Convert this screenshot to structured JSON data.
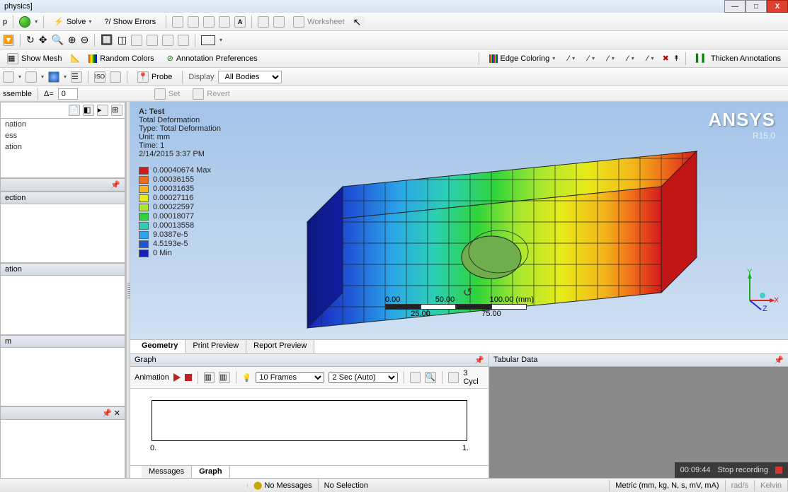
{
  "window": {
    "title_fragment": "physics]"
  },
  "window_buttons": {
    "min": "—",
    "max": "□",
    "close": "X"
  },
  "toolbar1": {
    "p_label": "p",
    "solve": "Solve",
    "show_errors": "?/ Show Errors",
    "worksheet": "Worksheet"
  },
  "toolbar3": {
    "show_mesh": "Show Mesh",
    "random_colors": "Random Colors",
    "annotation_prefs": "Annotation Preferences",
    "edge_coloring": "Edge Coloring",
    "thicken": "Thicken Annotations"
  },
  "toolbar4": {
    "assemble": "ssemble",
    "delta_eq": "Δ=",
    "delta_val": "0",
    "set": "Set",
    "revert": "Revert",
    "iso": "ISO",
    "probe": "Probe",
    "display": "Display",
    "bodies": "All Bodies"
  },
  "tree": {
    "items": [
      "nation",
      "ess",
      "ation"
    ]
  },
  "sidebar_headers": {
    "ection": "ection",
    "ation": "ation",
    "m": "m"
  },
  "legend": {
    "title": "A: Test",
    "subject": "Total Deformation",
    "type": "Type: Total Deformation",
    "unit": "Unit: mm",
    "time": "Time: 1",
    "date": "2/14/2015 3:37 PM",
    "entries": [
      {
        "c": "#d21a1a",
        "v": "0.00040674 Max"
      },
      {
        "c": "#ef6a1a",
        "v": "0.00036155"
      },
      {
        "c": "#f3b51a",
        "v": "0.00031635"
      },
      {
        "c": "#e8ea1a",
        "v": "0.00027116"
      },
      {
        "c": "#a9e82f",
        "v": "0.00022597"
      },
      {
        "c": "#2fd43b",
        "v": "0.00018077"
      },
      {
        "c": "#2bd0b4",
        "v": "0.00013558"
      },
      {
        "c": "#2ba6e8",
        "v": "9.0387e-5"
      },
      {
        "c": "#1f56d6",
        "v": "4.5193e-5"
      },
      {
        "c": "#1422b8",
        "v": "0 Min"
      }
    ]
  },
  "brand": {
    "logo": "ANSYS",
    "version": "R15.0"
  },
  "triad": {
    "x": "X",
    "y": "Y",
    "z": "Z"
  },
  "scale": {
    "t0": "0.00",
    "t1": "50.00",
    "t2": "100.00 (mm)",
    "b0": "25.00",
    "b1": "75.00"
  },
  "view_tabs": {
    "geometry": "Geometry",
    "print": "Print Preview",
    "report": "Report Preview"
  },
  "graph": {
    "header": "Graph",
    "animation": "Animation",
    "frames": "10 Frames",
    "duration": "2 Sec (Auto)",
    "cycles": "3 Cycl",
    "axis0": "0.",
    "axis1": "1."
  },
  "tabular": {
    "header": "Tabular Data"
  },
  "msg_tabs": {
    "messages": "Messages",
    "graph": "Graph"
  },
  "status": {
    "no_messages": "No Messages",
    "no_selection": "No Selection",
    "units": "Metric (mm, kg, N, s, mV, mA)",
    "rad": "rad/s",
    "kelvin": "Kelvin"
  },
  "recording": {
    "time": "00:09:44",
    "stop": "Stop recording"
  }
}
